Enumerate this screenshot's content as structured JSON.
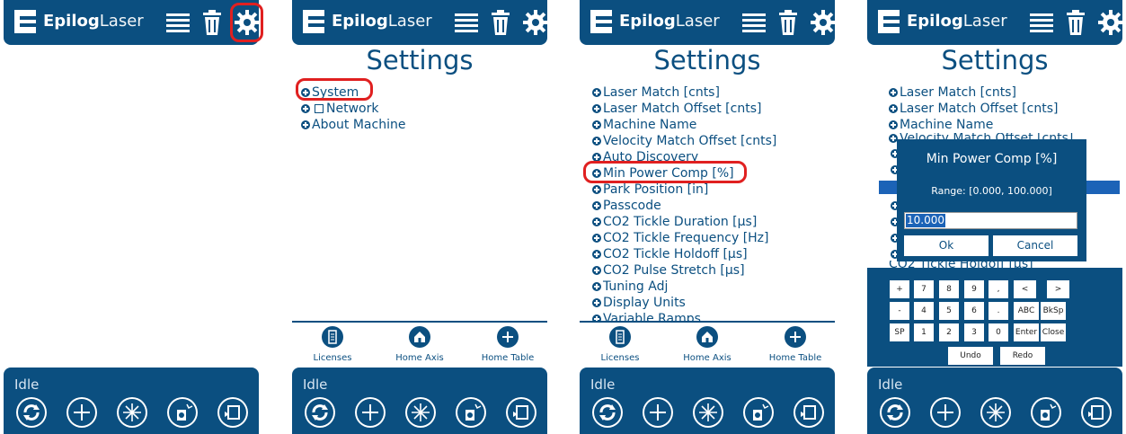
{
  "brand": {
    "bold": "Epilog",
    "light": "Laser"
  },
  "icons": {
    "list": "list-icon",
    "trash": "trash-icon",
    "gear": "gear-icon"
  },
  "settings_title": "Settings",
  "status": "Idle",
  "menu_top": [
    {
      "label": "System"
    },
    {
      "label": "Network"
    },
    {
      "label": "About Machine"
    }
  ],
  "menu_system": [
    "Laser Match [cnts]",
    "Laser Match Offset [cnts]",
    "Machine Name",
    "Velocity Match Offset [cnts]",
    "Auto Discovery",
    "Min Power Comp [%]",
    "Park Position [in]",
    "Passcode",
    "CO2 Tickle Duration [µs]",
    "CO2 Tickle Frequency [Hz]",
    "CO2 Tickle Holdoff [µs]",
    "CO2 Pulse Stretch [µs]",
    "Tuning Adj",
    "Display Units",
    "Variable Ramps"
  ],
  "menu_panel4": [
    "Laser Match [cnts]",
    "Laser Match Offset [cnts]",
    "Machine Name",
    "Velocity Match Offset [cnts]",
    "CO2 Tickle Holdoff [µs]"
  ],
  "bottom_nav": [
    {
      "label": "Licenses",
      "icon": "document-icon"
    },
    {
      "label": "Home Axis",
      "icon": "home-icon"
    },
    {
      "label": "Home Table",
      "icon": "crosshair-icon"
    }
  ],
  "status_buttons": [
    "refresh-icon",
    "jog-icon",
    "laser-icon",
    "focus-icon",
    "frame-icon"
  ],
  "dialog": {
    "title": "Min Power Comp [%]",
    "range": "Range: [0.000, 100.000]",
    "value": "10.000",
    "ok": "Ok",
    "cancel": "Cancel"
  },
  "keyboard": {
    "row1": [
      "+",
      "7",
      "8",
      "9",
      ",",
      "<",
      ">"
    ],
    "row2": [
      "-",
      "4",
      "5",
      "6",
      ".",
      "ABC",
      "BkSp"
    ],
    "row3": [
      "SP",
      "1",
      "2",
      "3",
      "0",
      "Enter",
      "Close"
    ],
    "row4": [
      "Undo",
      "Redo"
    ]
  },
  "colors": {
    "primary": "#0b4f80",
    "highlight": "#e02020",
    "selection": "#1c63b7"
  }
}
